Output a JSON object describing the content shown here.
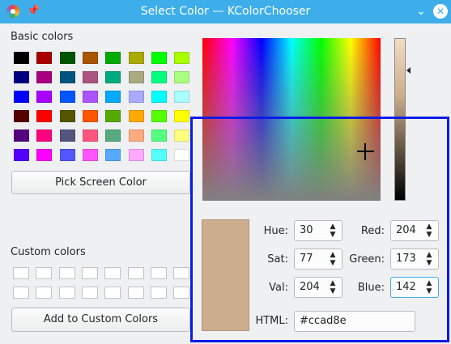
{
  "window": {
    "title": "Select Color — KColorChooser"
  },
  "titlebar": {
    "app_icon": "color-wheel-icon",
    "pin_icon": "pin-icon",
    "min_icon": "chevron-down-icon",
    "close_icon": "close-icon"
  },
  "basic": {
    "label": "Basic colors",
    "colors": [
      [
        "#000000",
        "#aa0000",
        "#005500",
        "#aa5500",
        "#00aa00",
        "#aaaa00",
        "#00ff00",
        "#aaff00"
      ],
      [
        "#00007f",
        "#aa007f",
        "#00557f",
        "#aa557f",
        "#00aa7f",
        "#aaaa7f",
        "#00ff7f",
        "#aaff7f"
      ],
      [
        "#0000ff",
        "#aa00ff",
        "#0055ff",
        "#aa55ff",
        "#00aaff",
        "#aaaaff",
        "#00ffff",
        "#aaffff"
      ],
      [
        "#550000",
        "#ff0000",
        "#555500",
        "#ff5500",
        "#55aa00",
        "#ffaa00",
        "#55ff00",
        "#ffff00"
      ],
      [
        "#55007f",
        "#ff007f",
        "#55557f",
        "#ff557f",
        "#55aa7f",
        "#ffaa7f",
        "#55ff7f",
        "#ffff7f"
      ],
      [
        "#5500ff",
        "#ff00ff",
        "#5555ff",
        "#ff55ff",
        "#55aaff",
        "#ffaaff",
        "#55ffff",
        "#ffffff"
      ]
    ]
  },
  "pick_button": "Pick Screen Color",
  "custom": {
    "label": "Custom colors",
    "rows": 2,
    "cols": 8
  },
  "add_button": "Add to Custom Colors",
  "current_color": "#ccad8e",
  "value_bar": {
    "arrow_fraction": 0.2
  },
  "fields": {
    "hue": {
      "label": "Hue:",
      "value": "30"
    },
    "sat": {
      "label": "Sat:",
      "value": "77"
    },
    "val": {
      "label": "Val:",
      "value": "204"
    },
    "red": {
      "label": "Red:",
      "value": "204"
    },
    "green": {
      "label": "Green:",
      "value": "173"
    },
    "blue": {
      "label": "Blue:",
      "value": "142"
    },
    "html": {
      "label": "HTML:",
      "value": "#ccad8e"
    }
  }
}
